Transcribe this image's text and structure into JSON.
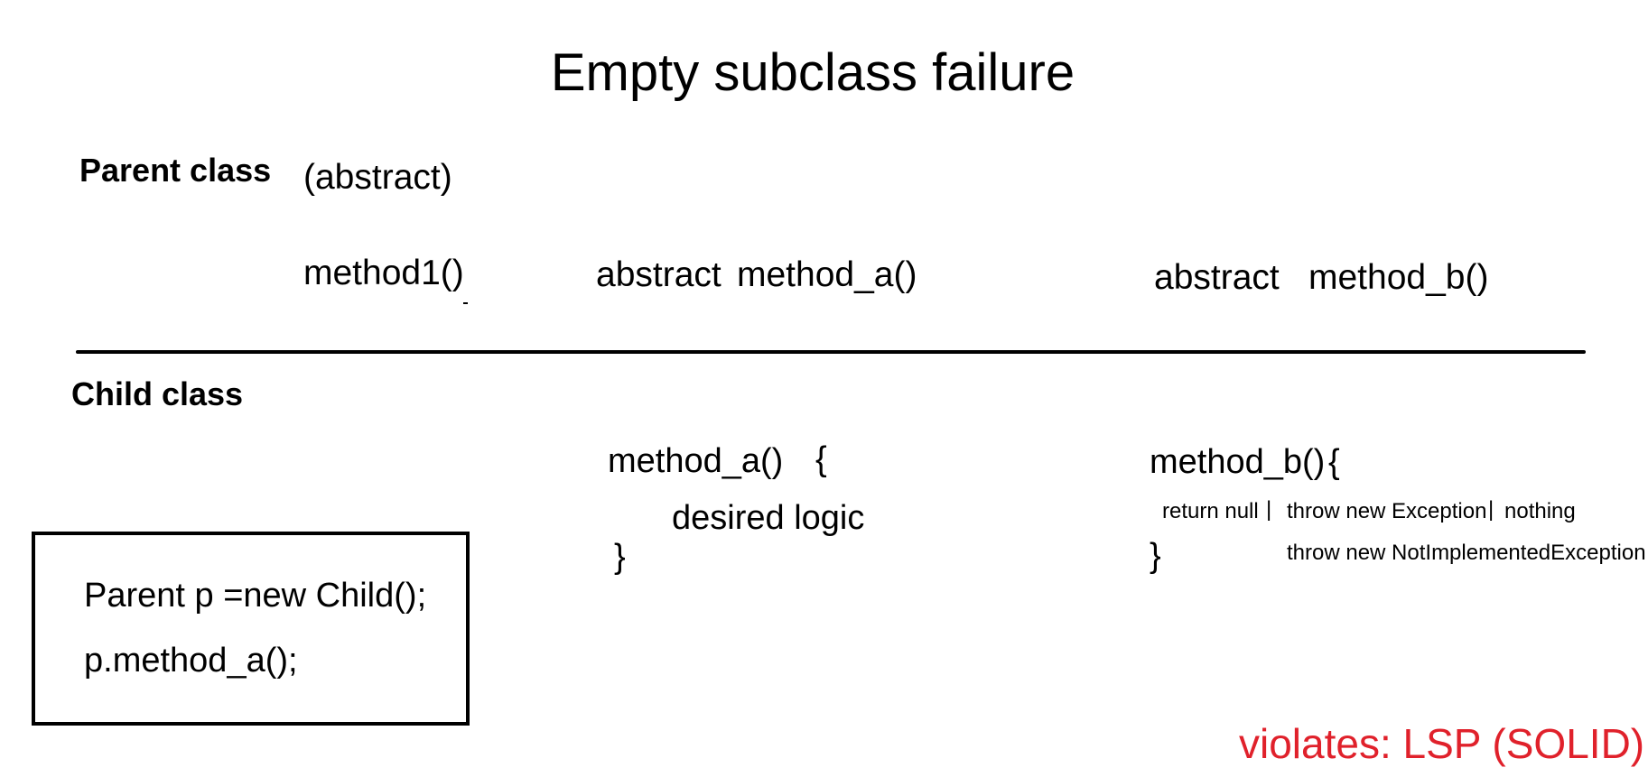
{
  "title": "Empty subclass failure",
  "parent": {
    "label": "Parent class",
    "note": "(abstract)",
    "method1": "method1()",
    "method_a": {
      "keyword": "abstract",
      "name": "method_a()"
    },
    "method_b": {
      "keyword": "abstract",
      "name": "method_b()"
    }
  },
  "child": {
    "label": "Child class",
    "method_a": {
      "signature": "method_a()",
      "open_brace": "{",
      "body": "desired logic",
      "close_brace": "}"
    },
    "method_b": {
      "signature": "method_b()",
      "open_brace": "{",
      "option_1": "return null",
      "separator": "|",
      "option_2": "throw new Exception",
      "option_3": "nothing",
      "option_4": "throw new NotImplementedException",
      "close_brace": "}"
    }
  },
  "code_example": {
    "line1": "Parent p =new Child();",
    "line2": "p.method_a();"
  },
  "violation": "violates: LSP (SOLID)",
  "colors": {
    "violation_text": "#e0212b",
    "text": "#000000",
    "background": "#ffffff"
  }
}
